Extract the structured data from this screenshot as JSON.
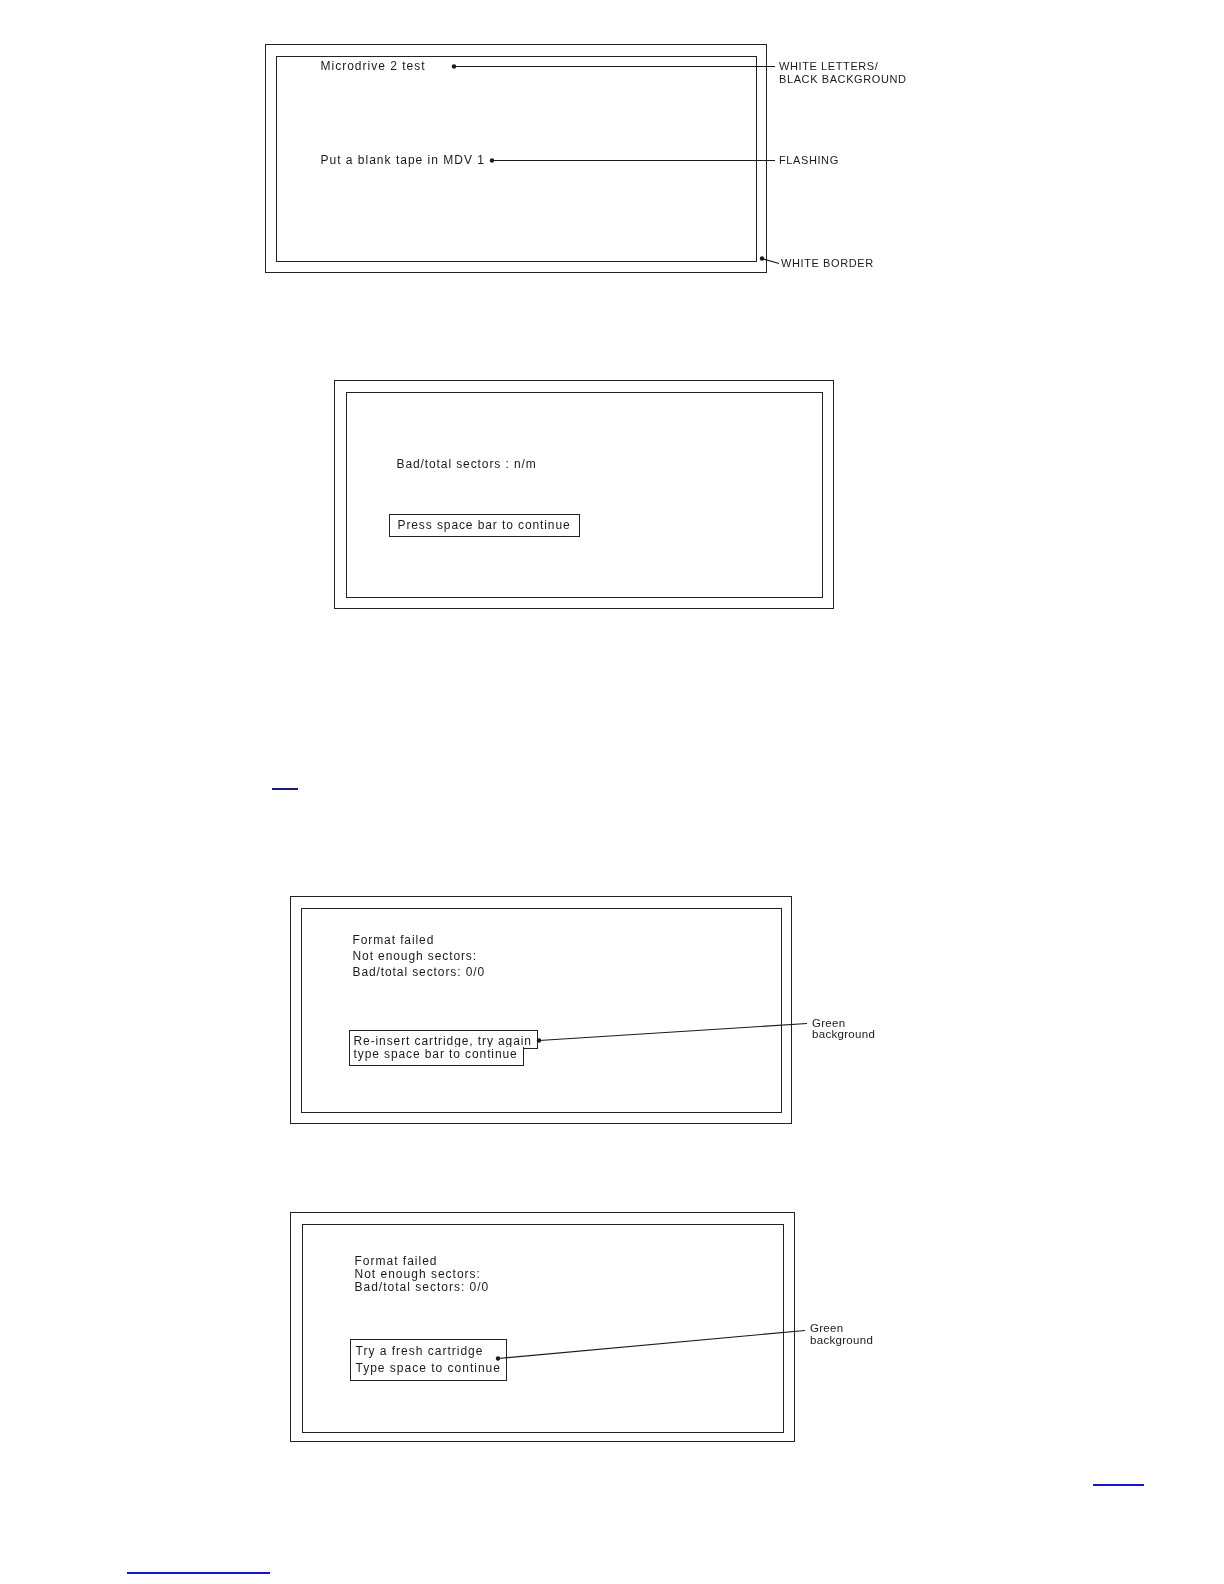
{
  "figures": [
    {
      "screen": {
        "lines": [
          "Microdrive 2 test",
          "Put a blank tape in MDV 1"
        ]
      },
      "callouts": [
        {
          "lines": [
            "WHITE LETTERS/",
            "BLACK BACKGROUND"
          ]
        },
        {
          "lines": [
            "FLASHING"
          ]
        },
        {
          "lines": [
            "WHITE BORDER"
          ]
        }
      ]
    },
    {
      "screen": {
        "lines": [
          "Bad/total sectors : n/m"
        ],
        "box": {
          "kind": "rectangle",
          "lines": [
            "Press space bar to continue"
          ]
        }
      }
    },
    {
      "screen": {
        "lines": [
          "Format failed",
          "Not enough sectors:",
          "Bad/total sectors: 0/0"
        ],
        "box": {
          "kind": "stepped",
          "lines": [
            "Re-insert cartridge, try again",
            "type space bar to continue"
          ]
        }
      },
      "callouts": [
        {
          "lines": [
            "Green",
            "background"
          ]
        }
      ]
    },
    {
      "screen": {
        "lines": [
          "Format failed",
          "Not enough sectors:",
          "Bad/total sectors: 0/0"
        ],
        "box": {
          "kind": "rectangle",
          "lines": [
            "Try a fresh cartridge",
            "Type space to continue"
          ]
        }
      },
      "callouts": [
        {
          "lines": [
            "Green",
            "background"
          ]
        }
      ]
    }
  ]
}
